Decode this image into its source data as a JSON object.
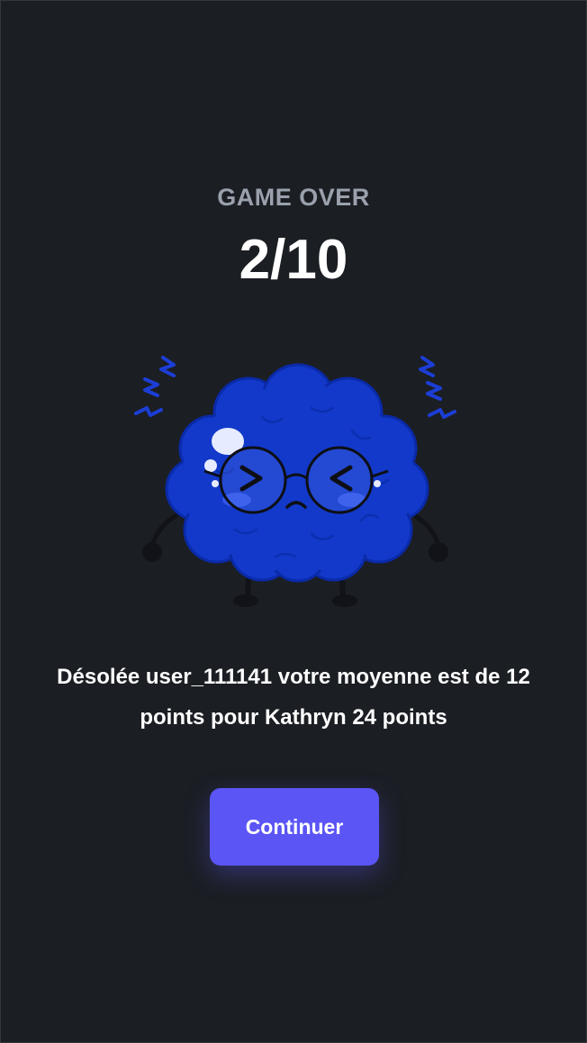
{
  "game": {
    "title": "GAME OVER",
    "score": "2/10",
    "message": "Désolée user_111141 votre moyenne est de 12 points pour Kathryn 24 points",
    "continue_label": "Continuer",
    "mascot_icon": "sad-brain-icon"
  },
  "colors": {
    "background": "#1b1e23",
    "title": "#9aa1ac",
    "text": "#ffffff",
    "button": "#5b55f5",
    "brain": "#1239c9"
  }
}
